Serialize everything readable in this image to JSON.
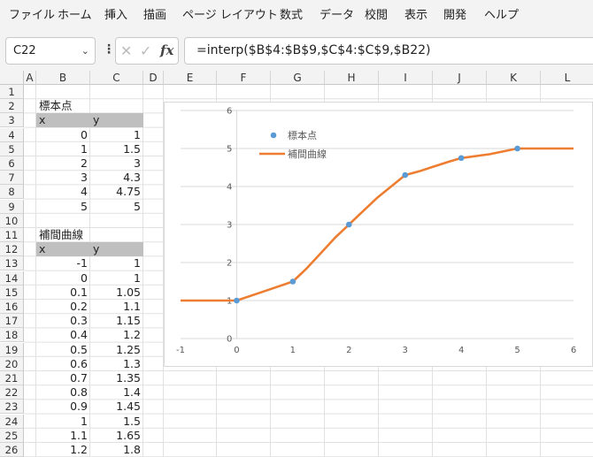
{
  "menu": {
    "items": [
      "ファイル",
      "ホーム",
      "挿入",
      "描画",
      "ページ レイアウト",
      "数式",
      "データ",
      "校閲",
      "表示",
      "開発",
      "ヘルプ"
    ]
  },
  "formula_bar": {
    "name_box": "C22",
    "formula": "=interp($B$4:$B$9,$C$4:$C$9,$B22)",
    "fx_label": "fx"
  },
  "sheet": {
    "columns": [
      "A",
      "B",
      "C",
      "D",
      "E",
      "F",
      "G",
      "H",
      "I",
      "J",
      "K",
      "L"
    ],
    "rows": [
      "1",
      "2",
      "3",
      "4",
      "5",
      "6",
      "7",
      "8",
      "9",
      "10",
      "11",
      "12",
      "13",
      "14",
      "15",
      "16",
      "17",
      "18",
      "19",
      "20",
      "21",
      "22",
      "23",
      "24",
      "25",
      "26"
    ],
    "sample_title": "標本点",
    "sample_header": [
      "x",
      "y"
    ],
    "sample_points": [
      [
        "0",
        "1"
      ],
      [
        "1",
        "1.5"
      ],
      [
        "2",
        "3"
      ],
      [
        "3",
        "4.3"
      ],
      [
        "4",
        "4.75"
      ],
      [
        "5",
        "5"
      ]
    ],
    "interp_title": "補間曲線",
    "interp_header": [
      "x",
      "y"
    ],
    "interp_points": [
      [
        "-1",
        "1"
      ],
      [
        "0",
        "1"
      ],
      [
        "0.1",
        "1.05"
      ],
      [
        "0.2",
        "1.1"
      ],
      [
        "0.3",
        "1.15"
      ],
      [
        "0.4",
        "1.2"
      ],
      [
        "0.5",
        "1.25"
      ],
      [
        "0.6",
        "1.3"
      ],
      [
        "0.7",
        "1.35"
      ],
      [
        "0.8",
        "1.4"
      ],
      [
        "0.9",
        "1.45"
      ],
      [
        "1",
        "1.5"
      ],
      [
        "1.1",
        "1.65"
      ],
      [
        "1.2",
        "1.8"
      ]
    ]
  },
  "chart_data": {
    "type": "scatter",
    "legend_position": "top-left",
    "xlim": [
      -1,
      6
    ],
    "ylim": [
      0,
      6
    ],
    "x_ticks": [
      "-1",
      "0",
      "1",
      "2",
      "3",
      "4",
      "5",
      "6"
    ],
    "y_ticks": [
      "0",
      "1",
      "2",
      "3",
      "4",
      "5",
      "6"
    ],
    "series": [
      {
        "name": "標本点",
        "kind": "markers",
        "color": "#5b9bd5",
        "x": [
          0,
          1,
          2,
          3,
          4,
          5
        ],
        "y": [
          1,
          1.5,
          3,
          4.3,
          4.75,
          5
        ]
      },
      {
        "name": "補間曲線",
        "kind": "line",
        "color": "#ed7d31",
        "x": [
          -1,
          0,
          0.5,
          1,
          1.25,
          1.5,
          1.75,
          2,
          2.25,
          2.5,
          2.75,
          3,
          3.25,
          3.5,
          3.75,
          4,
          4.5,
          5,
          6
        ],
        "y": [
          1,
          1,
          1.25,
          1.5,
          1.85,
          2.25,
          2.65,
          3,
          3.35,
          3.7,
          4.0,
          4.3,
          4.4,
          4.52,
          4.64,
          4.75,
          4.85,
          5,
          5
        ]
      }
    ]
  }
}
